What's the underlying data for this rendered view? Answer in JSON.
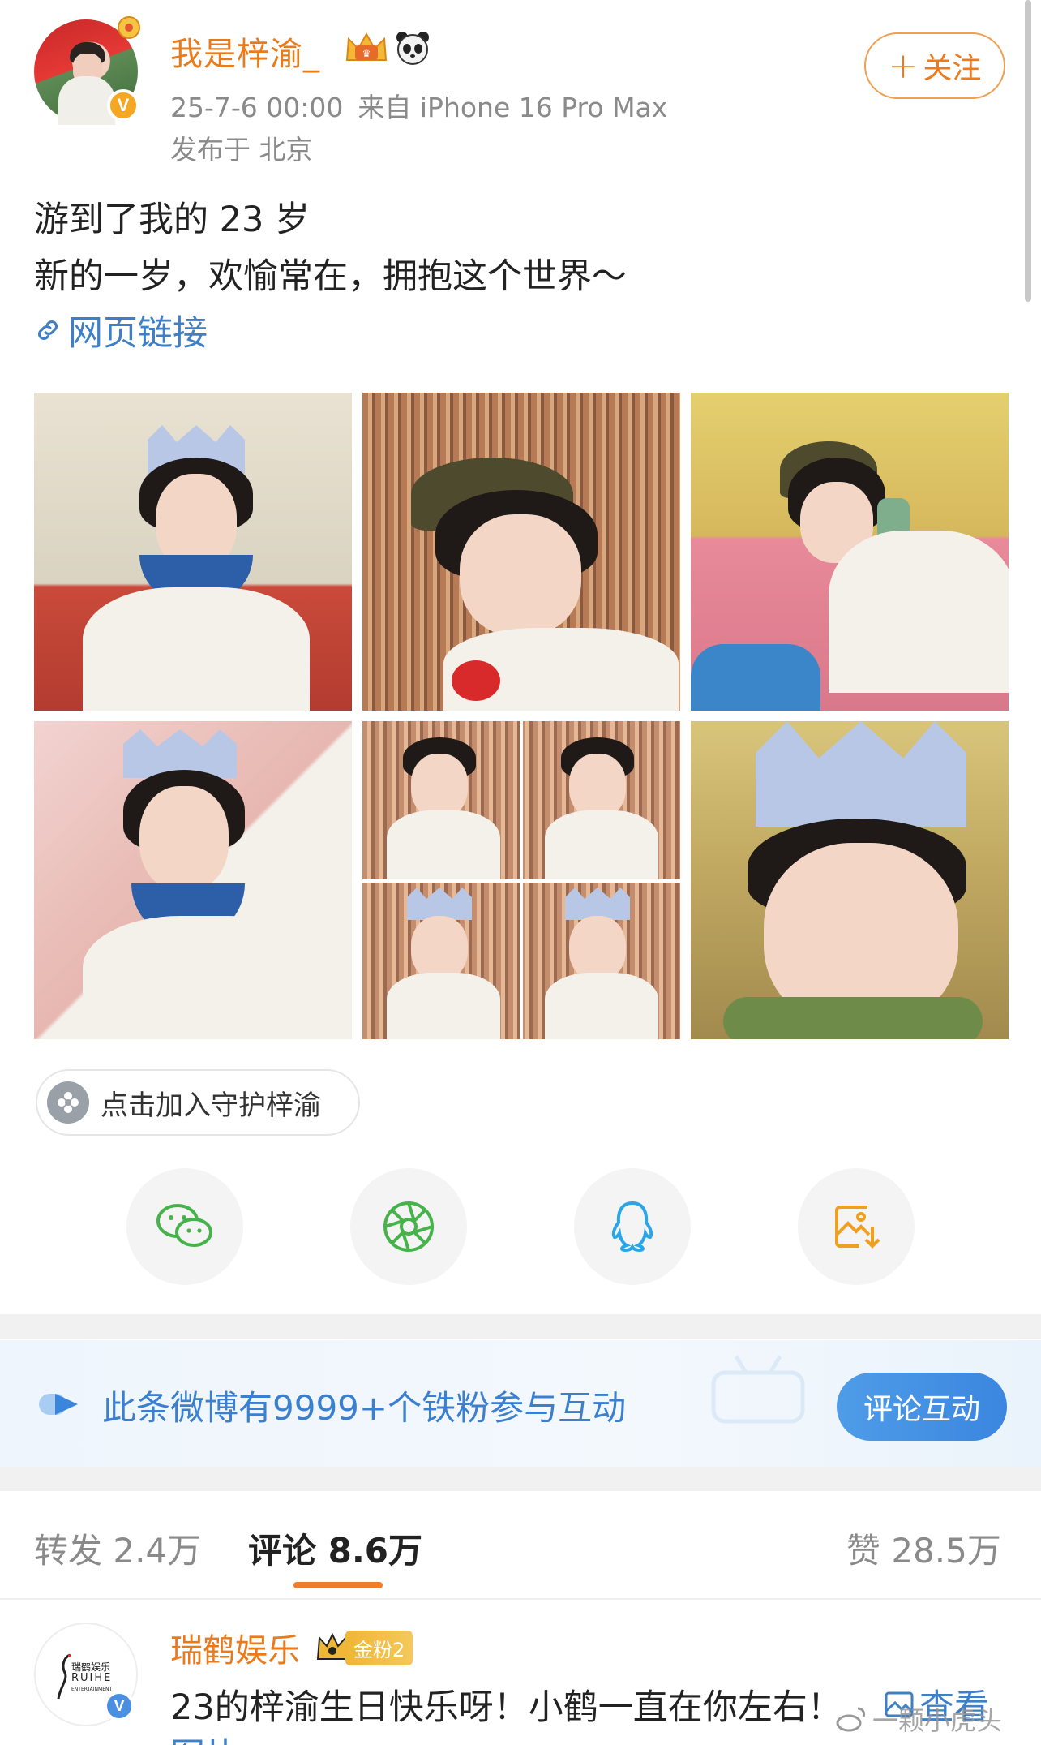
{
  "post": {
    "username": "我是梓渝_",
    "timestamp": "25-7-6 00:00",
    "source": "来自 iPhone 16 Pro Max",
    "location": "发布于 北京",
    "follow_label": "关注",
    "text_line1": "游到了我的 23 岁",
    "text_line2": "新的一岁，欢愉常在，拥抱这个世界～",
    "web_link_label": "网页链接",
    "verified_mark": "V"
  },
  "photos": [
    "photo-1",
    "photo-2",
    "photo-3",
    "photo-4",
    "photo-5",
    "photo-6"
  ],
  "fan_group": {
    "label": "点击加入守护梓渝"
  },
  "share_icons": [
    "wechat-icon",
    "moments-icon",
    "qq-icon",
    "save-image-icon"
  ],
  "banner": {
    "text": "此条微博有9999+个铁粉参与互动",
    "button_label": "评论互动"
  },
  "tabs": {
    "repost": "转发 2.4万",
    "comment": "评论 8.6万",
    "like": "赞 28.5万"
  },
  "comment": {
    "username": "瑞鹤娱乐",
    "fan_badge": "金粉2",
    "text": "23的梓渝生日快乐呀！小鹤一直在你左右！",
    "link_label": "查看",
    "continuation": "图片",
    "avatar_logo_line1": "瑞鹤娱乐",
    "avatar_logo_line2": "RUIHE",
    "avatar_logo_line3": "ENTERTAINMENT",
    "verified_mark": "V"
  },
  "watermark": "一颗小虎头",
  "colors": {
    "username": "#ea7a1a",
    "link": "#3f7fc6",
    "accent_orange": "#f07d28",
    "banner_blue": "#3a7fd0"
  }
}
